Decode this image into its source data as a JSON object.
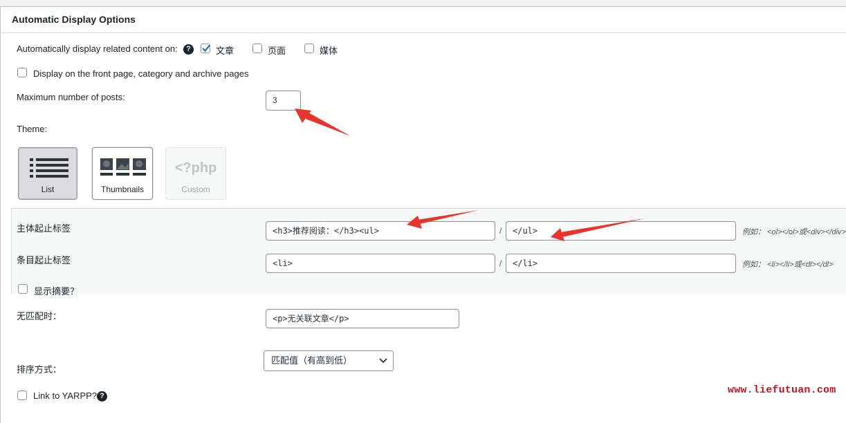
{
  "panel": {
    "title": "Automatic Display Options"
  },
  "auto_display": {
    "label": "Automatically display related content on:",
    "help_icon": "question-circle-icon",
    "options": [
      {
        "label": "文章",
        "checked": true
      },
      {
        "label": "页面",
        "checked": false
      },
      {
        "label": "媒体",
        "checked": false
      }
    ]
  },
  "front_page": {
    "label": "Display on the front page, category and archive pages",
    "checked": false
  },
  "max_posts": {
    "label": "Maximum number of posts:",
    "value": "3"
  },
  "theme": {
    "label": "Theme:",
    "options": [
      {
        "label": "List",
        "icon": "list-icon",
        "selected": true
      },
      {
        "label": "Thumbnails",
        "icon": "thumbnails-icon",
        "selected": false
      },
      {
        "label": "Custom",
        "icon": "php-icon",
        "icon_text": "<?php",
        "disabled": true
      }
    ]
  },
  "body_tags": {
    "label": "主体起止标签",
    "open_value": "<h3>推荐阅读：</h3><ul>",
    "separator": "/",
    "close_value": "</ul>",
    "hint": "例如： <ol></ol>或<div></div>"
  },
  "item_tags": {
    "label": "条目起止标签",
    "open_value": "<li>",
    "separator": "/",
    "close_value": "</li>",
    "hint": "例如： <li></li>或<dl></dl>"
  },
  "excerpt": {
    "label": "显示摘要？",
    "checked": false
  },
  "no_match": {
    "label": "无匹配时：",
    "value": "<p>无关联文章</p>"
  },
  "order": {
    "label": "排序方式：",
    "selected": "匹配值（有高到低）"
  },
  "link_yarpp": {
    "label": "Link to YARPP?",
    "checked": false,
    "help_icon": "question-circle-icon"
  },
  "watermark": "www.liefutuan.com",
  "colors": {
    "annotation_arrow": "#e8352c",
    "checkbox_check": "#2271b1",
    "watermark": "#c4141f"
  }
}
